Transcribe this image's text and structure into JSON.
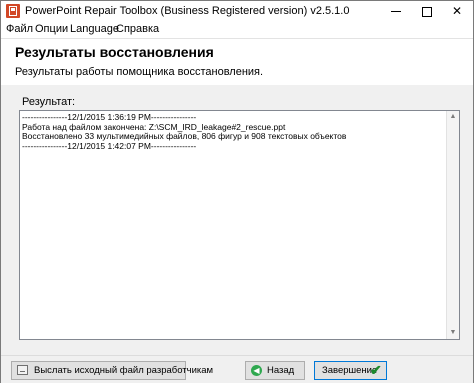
{
  "window": {
    "title": "PowerPoint Repair Toolbox (Business Registered version) v2.5.1.0",
    "minimize": "",
    "maximize": "",
    "close": "✕"
  },
  "menu": {
    "items": [
      "Файл",
      "Опции",
      "Language",
      "Справка"
    ]
  },
  "header": {
    "title": "Результаты восстановления",
    "subtitle": "Результаты работы помощника восстановления."
  },
  "content": {
    "result_label": "Результат:",
    "log_lines": [
      "----------------12/1/2015 1:36:19 PM----------------",
      "Работа над файлом закончена: Z:\\SCM_IRD_leakage#2_rescue.ppt",
      "Восстановлено 33 мультимедийных файлов, 806 фигур и 908 текстовых объектов",
      "----------------12/1/2015 1:42:07 PM----------------"
    ]
  },
  "footer": {
    "send_label": "Выслать исходный файл разработчикам",
    "back_label": "Назад",
    "finish_label": "Завершение"
  },
  "icons": {
    "app": "powerpoint-app-icon",
    "send": "envelope-icon",
    "back": "back-arrow-icon",
    "finish": "checkmark-icon"
  },
  "colors": {
    "app_icon": "#d24726",
    "accent_border": "#0078d7",
    "back_icon": "#2fa84f",
    "check": "#1d8a2c"
  }
}
